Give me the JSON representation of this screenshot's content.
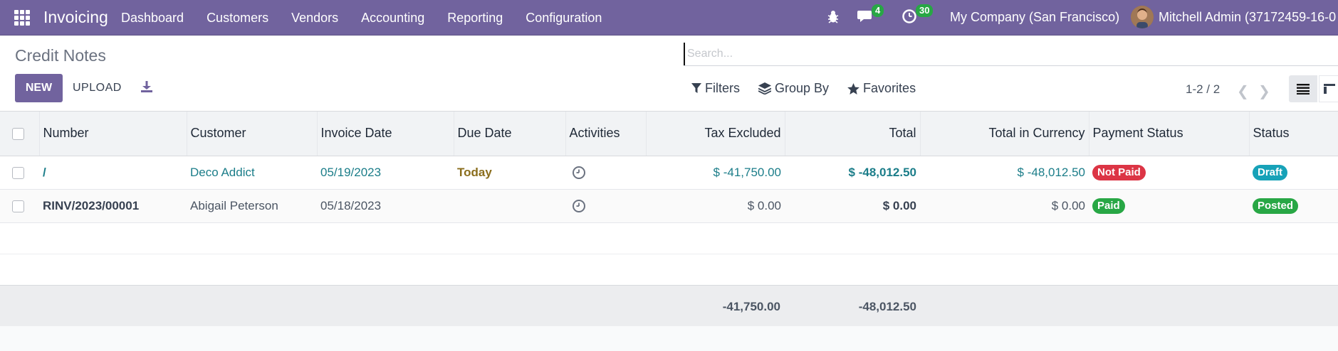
{
  "app": {
    "name": "Invoicing"
  },
  "menu": [
    {
      "label": "Dashboard"
    },
    {
      "label": "Customers"
    },
    {
      "label": "Vendors"
    },
    {
      "label": "Accounting"
    },
    {
      "label": "Reporting"
    },
    {
      "label": "Configuration"
    }
  ],
  "systray": {
    "messages_count": "4",
    "activities_count": "30",
    "company": "My Company (San Francisco)",
    "user": "Mitchell Admin (37172459-16-0"
  },
  "control": {
    "title": "Credit Notes",
    "new_label": "NEW",
    "upload_label": "UPLOAD",
    "search_placeholder": "Search...",
    "filters_label": "Filters",
    "groupby_label": "Group By",
    "favorites_label": "Favorites",
    "pager": "1-2 / 2"
  },
  "table": {
    "headers": {
      "number": "Number",
      "customer": "Customer",
      "invoice_date": "Invoice Date",
      "due_date": "Due Date",
      "activities": "Activities",
      "tax_excluded": "Tax Excluded",
      "total": "Total",
      "total_currency": "Total in Currency",
      "payment_status": "Payment Status",
      "status": "Status"
    },
    "rows": [
      {
        "number": "/",
        "customer": "Deco Addict",
        "invoice_date": "05/19/2023",
        "due_date": "Today",
        "tax_excluded": "$ -41,750.00",
        "total": "$ -48,012.50",
        "total_currency": "$ -48,012.50",
        "payment_status": "Not Paid",
        "status": "Draft"
      },
      {
        "number": "RINV/2023/00001",
        "customer": "Abigail Peterson",
        "invoice_date": "05/18/2023",
        "due_date": "",
        "tax_excluded": "$ 0.00",
        "total": "$ 0.00",
        "total_currency": "$ 0.00",
        "payment_status": "Paid",
        "status": "Posted"
      }
    ],
    "totals": {
      "tax_excluded": "-41,750.00",
      "total": "-48,012.50"
    }
  },
  "colors": {
    "brand": "#71639e",
    "link": "#1b7d89",
    "not_paid": "#dc3545",
    "paid": "#28a745",
    "draft": "#17a2b8"
  }
}
